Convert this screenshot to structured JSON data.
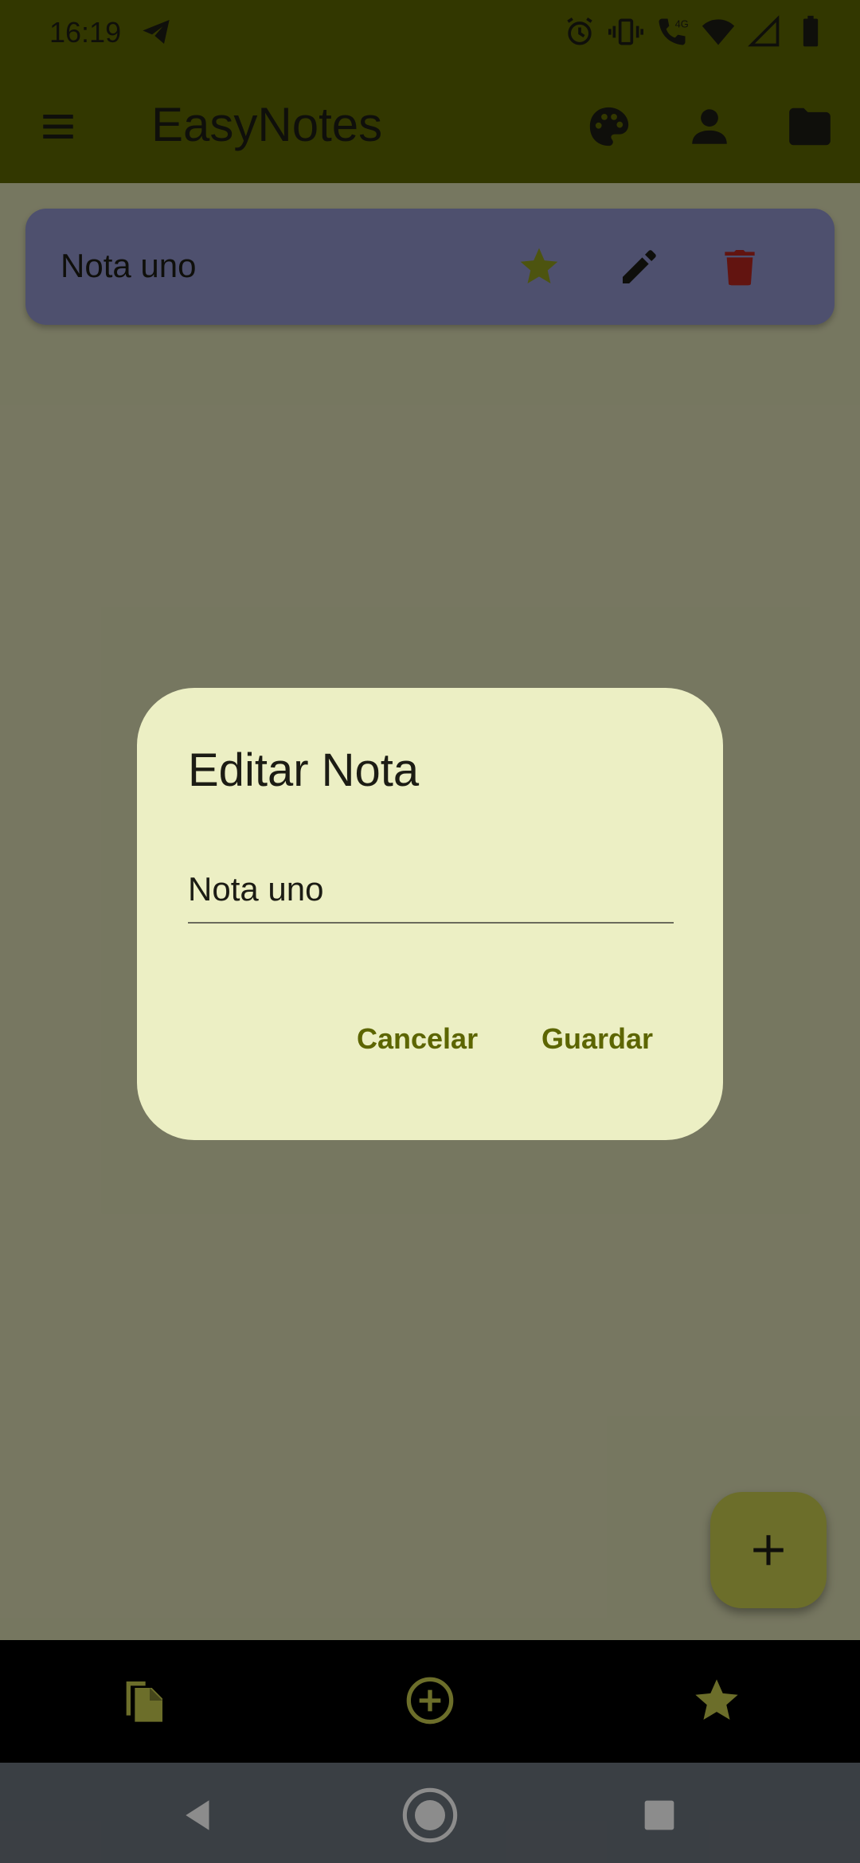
{
  "status_bar": {
    "time": "16:19",
    "network_label": "4G",
    "icons": [
      "telegram-icon",
      "alarm-icon",
      "vibrate-icon",
      "volte-call-icon",
      "wifi-icon",
      "signal-icon",
      "battery-icon"
    ]
  },
  "app_bar": {
    "title": "EasyNotes",
    "actions": [
      "menu-icon",
      "palette-icon",
      "person-icon",
      "folder-icon"
    ]
  },
  "notes": [
    {
      "title": "Nota uno",
      "favorite": true,
      "actions": [
        "star-icon",
        "edit-icon",
        "delete-icon"
      ]
    }
  ],
  "dialog": {
    "title": "Editar Nota",
    "input_value": "Nota uno",
    "cancel_label": "Cancelar",
    "save_label": "Guardar"
  },
  "fab": {
    "icon": "plus-icon"
  },
  "bottom_nav": {
    "items": [
      "notes-icon",
      "add-circle-icon",
      "star-icon"
    ]
  },
  "system_nav": {
    "items": [
      "back-icon",
      "home-icon",
      "recents-icon"
    ]
  },
  "colors": {
    "primary": "#5c6500",
    "card": "#8f92c9",
    "star": "#8c9a1d",
    "delete": "#b3261e",
    "dialog_bg": "#ecefc4",
    "fab": "#c5c84e"
  }
}
